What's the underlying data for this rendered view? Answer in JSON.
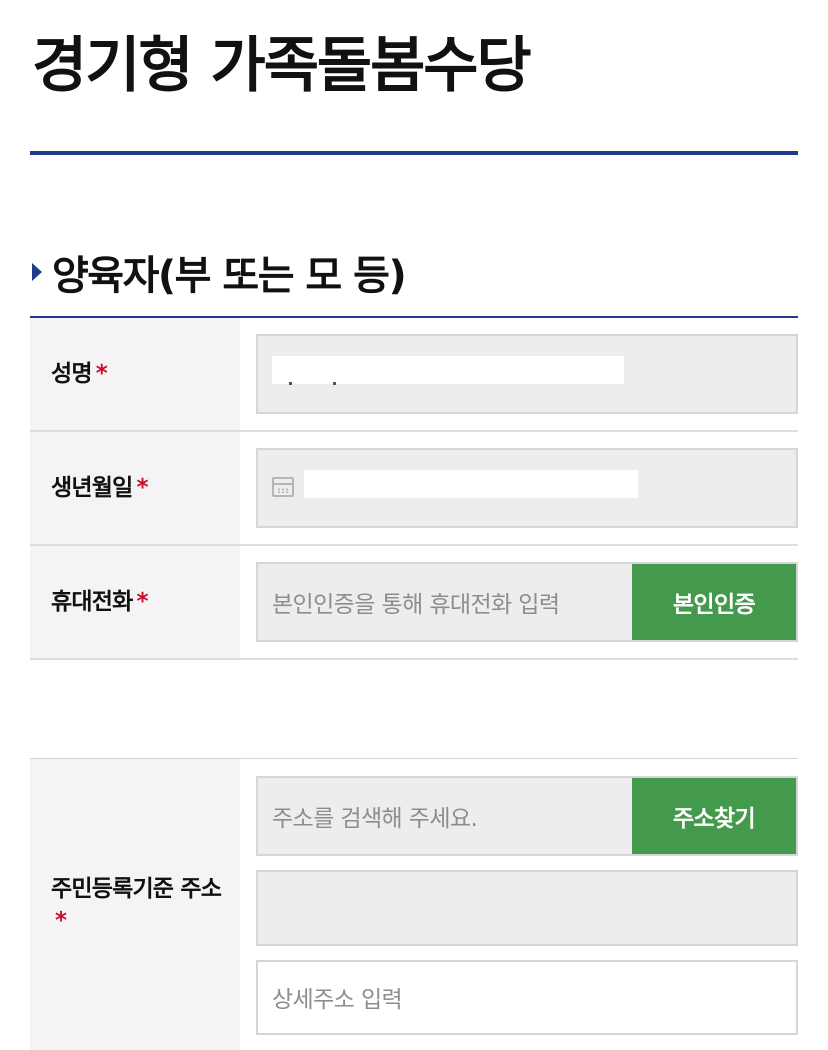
{
  "page": {
    "title": "경기형 가족돌봄수당"
  },
  "section": {
    "title": "양육자(부 또는 모 등)"
  },
  "fields": {
    "name": {
      "label": "성명",
      "required_mark": "*"
    },
    "birthdate": {
      "label": "생년월일",
      "required_mark": "*"
    },
    "phone": {
      "label": "휴대전화",
      "required_mark": "*",
      "placeholder": "본인인증을 통해 휴대전화 입력",
      "button_label": "본인인증"
    },
    "address": {
      "label": "주민등록기준 주소",
      "required_mark": "*",
      "search_placeholder": "주소를 검색해 주세요.",
      "search_button_label": "주소찾기",
      "detail_placeholder": "상세주소 입력"
    }
  },
  "colors": {
    "accent_blue": "#1f3b8c",
    "button_green": "#43994c",
    "required_red": "#c8102e"
  },
  "icons": {
    "birthdate": "calendar-icon"
  }
}
